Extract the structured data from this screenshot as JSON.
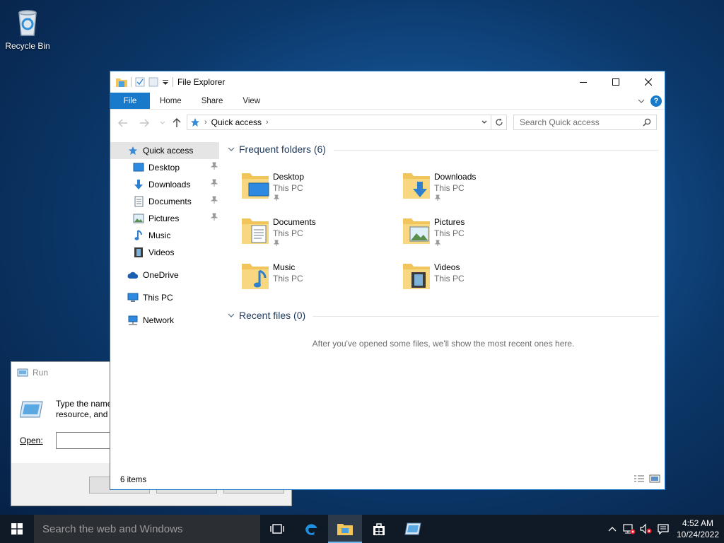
{
  "desktop": {
    "recycle_bin_label": "Recycle Bin"
  },
  "run_dialog": {
    "title": "Run",
    "description_line1": "Type the name",
    "description_line2": "resource, and W",
    "open_label": "Open:",
    "open_value": ""
  },
  "explorer": {
    "title": "File Explorer",
    "ribbon_tabs": [
      "File",
      "Home",
      "Share",
      "View"
    ],
    "help_label": "?",
    "breadcrumb": [
      "Quick access"
    ],
    "search_placeholder": "Search Quick access",
    "nav": {
      "quick_access": "Quick access",
      "desktop": "Desktop",
      "downloads": "Downloads",
      "documents": "Documents",
      "pictures": "Pictures",
      "music": "Music",
      "videos": "Videos",
      "onedrive": "OneDrive",
      "this_pc": "This PC",
      "network": "Network"
    },
    "frequent_header": "Frequent folders (6)",
    "frequent_folders": [
      {
        "name": "Desktop",
        "location": "This PC",
        "pinned": true,
        "icon": "desktop-folder-icon"
      },
      {
        "name": "Downloads",
        "location": "This PC",
        "pinned": true,
        "icon": "downloads-folder-icon"
      },
      {
        "name": "Documents",
        "location": "This PC",
        "pinned": true,
        "icon": "documents-folder-icon"
      },
      {
        "name": "Pictures",
        "location": "This PC",
        "pinned": true,
        "icon": "pictures-folder-icon"
      },
      {
        "name": "Music",
        "location": "This PC",
        "pinned": false,
        "icon": "music-folder-icon"
      },
      {
        "name": "Videos",
        "location": "This PC",
        "pinned": false,
        "icon": "videos-folder-icon"
      }
    ],
    "recent_header": "Recent files (0)",
    "recent_empty_message": "After you've opened some files, we'll show the most recent ones here.",
    "status_items": "6 items"
  },
  "taskbar": {
    "search_placeholder": "Search the web and Windows",
    "time": "4:52 AM",
    "date": "10/24/2022"
  },
  "colors": {
    "accent": "#1979ca",
    "taskbar": "#101a26",
    "folder_yellow": "#f2c55c"
  }
}
